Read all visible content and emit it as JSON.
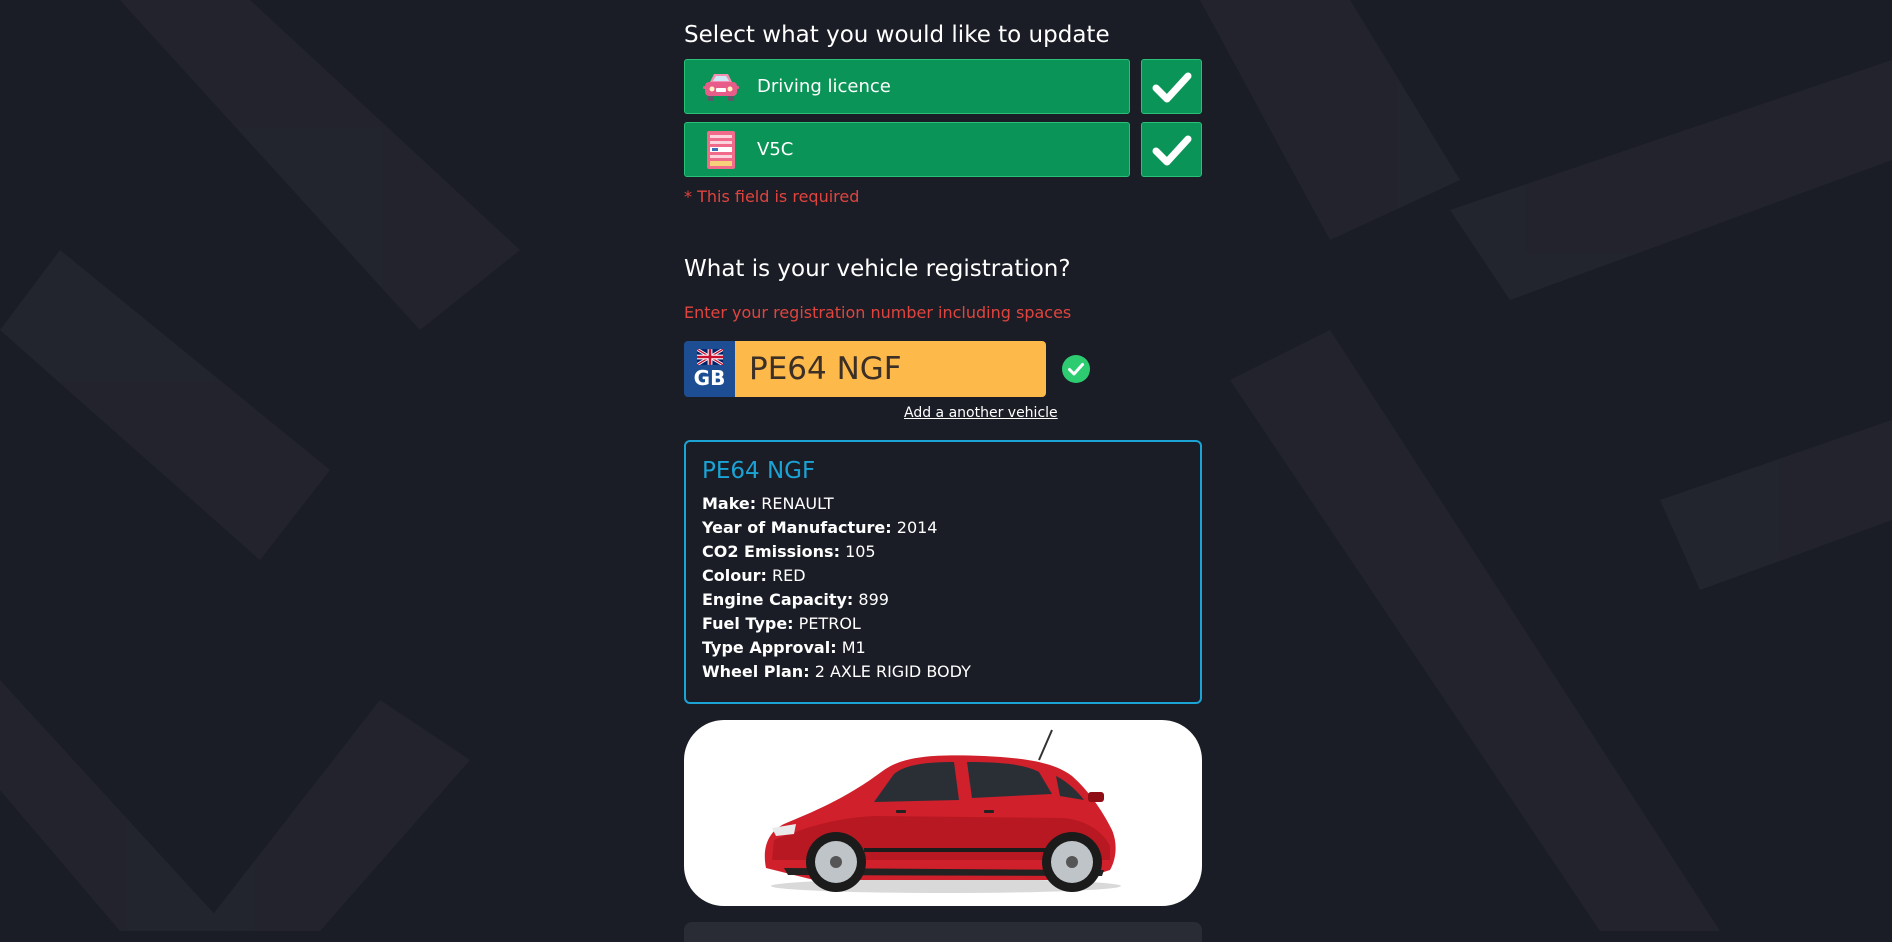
{
  "update_section": {
    "heading": "Select what you would like to update",
    "options": [
      {
        "label": "Driving licence",
        "icon": "car-icon",
        "checked": true
      },
      {
        "label": "V5C",
        "icon": "document-icon",
        "checked": true
      }
    ],
    "error": "* This field is required"
  },
  "registration_section": {
    "heading": "What is your vehicle registration?",
    "hint": "Enter your registration number including spaces",
    "country_code": "GB",
    "registration_value": "PE64 NGF",
    "add_vehicle_link": "Add a another vehicle"
  },
  "vehicle": {
    "registration": "PE64 NGF",
    "specs": [
      {
        "label": "Make:",
        "value": "RENAULT"
      },
      {
        "label": "Year of Manufacture:",
        "value": "2014"
      },
      {
        "label": "CO2 Emissions:",
        "value": "105"
      },
      {
        "label": "Colour:",
        "value": "RED"
      },
      {
        "label": "Engine Capacity:",
        "value": "899"
      },
      {
        "label": "Fuel Type:",
        "value": "PETROL"
      },
      {
        "label": "Type Approval:",
        "value": "M1"
      },
      {
        "label": "Wheel Plan:",
        "value": "2 AXLE RIGID BODY"
      }
    ],
    "image_icon": "car-photo"
  },
  "colors": {
    "background": "#1b1d26",
    "option_green": "#0a9457",
    "error_red": "#e0443e",
    "plate_yellow": "#fdb94a",
    "accent_blue": "#1aa3d4",
    "valid_green": "#2ecc71"
  }
}
